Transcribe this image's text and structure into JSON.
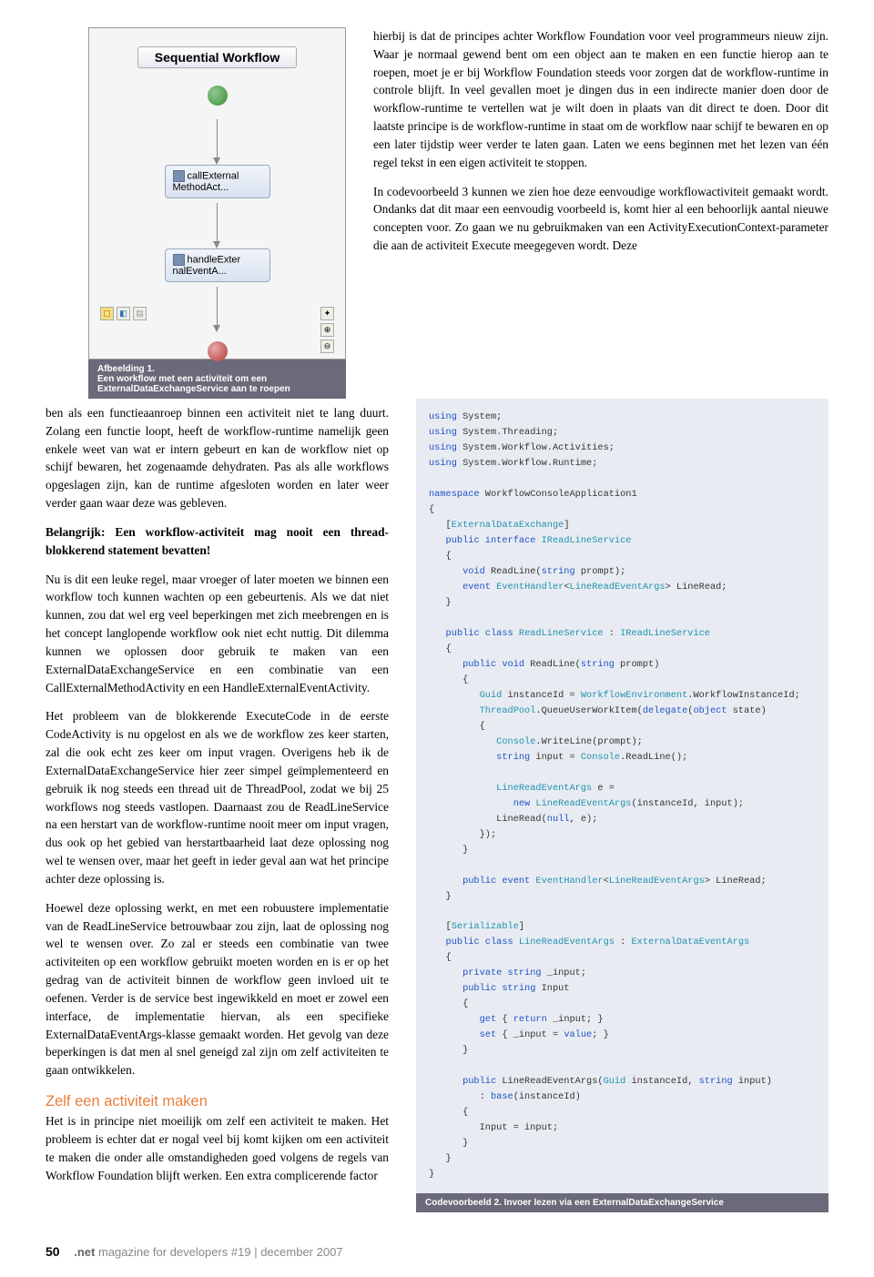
{
  "diagram": {
    "title": "Sequential Workflow",
    "activity1": "callExternal MethodAct...",
    "activity2": "handleExter nalEventA..."
  },
  "caption1_title": "Afbeelding 1.",
  "caption1_text": "Een workflow met een activiteit om een ExternalDataExchangeService aan te roepen",
  "right_p1": "hierbij is dat de principes achter Workflow Foundation voor veel programmeurs nieuw zijn. Waar je normaal gewend bent om een object aan te maken en een functie hierop aan te roepen, moet je er bij Workflow Foundation steeds voor zorgen dat de workflow-runtime in controle blijft. In veel gevallen moet je dingen dus in een indirecte manier doen door de workflow-runtime te vertellen wat je wilt doen in plaats van dit direct te doen. Door dit laatste principe is de workflow-runtime in staat om de workflow naar schijf te bewaren en op een later tijdstip weer verder te laten gaan. Laten we eens beginnen met het lezen van één regel tekst in een eigen activiteit te stoppen.",
  "right_p2": "In codevoorbeeld 3 kunnen we zien hoe deze eenvoudige workflowactiviteit gemaakt wordt. Ondanks dat dit maar een eenvoudig voorbeeld is, komt hier al een behoorlijk aantal nieuwe concepten voor. Zo gaan we nu gebruikmaken van een ActivityExecutionContext-parameter die aan de activiteit Execute meegegeven wordt. Deze",
  "left_p1": "ben als een functieaanroep binnen een activiteit niet te lang duurt. Zolang een functie loopt, heeft de workflow-runtime namelijk geen enkele weet van wat er intern gebeurt en kan de workflow niet op schijf bewaren, het zogenaamde dehydraten. Pas als alle workflows opgeslagen zijn, kan de runtime afgesloten worden en later weer verder gaan waar deze was gebleven.",
  "left_bold": "Belangrijk: Een workflow-activiteit mag nooit een thread-blokkerend statement bevatten!",
  "left_p2": "Nu is dit een leuke regel, maar vroeger of later moeten we binnen een workflow toch kunnen wachten op een gebeurtenis. Als we dat niet kunnen, zou dat wel erg veel beperkingen met zich meebrengen en is het concept langlopende workflow ook niet echt nuttig. Dit dilemma kunnen we oplossen door gebruik te maken van een ExternalDataExchangeService en een combinatie van een CallExternalMethodActivity en een HandleExternalEventActivity.",
  "left_p3": "Het probleem van de blokkerende ExecuteCode in de eerste CodeActivity is nu opgelost en als we de workflow zes keer starten, zal die ook echt zes keer om input vragen. Overigens heb ik de ExternalDataExchangeService hier zeer simpel geïmplementeerd en gebruik ik nog steeds een thread uit de ThreadPool, zodat we bij 25 workflows nog steeds vastlopen. Daarnaast zou de ReadLineService na een herstart van de workflow-runtime nooit meer om input vragen, dus ook op het gebied van herstartbaarheid laat deze oplossing nog wel te wensen over, maar het geeft in ieder geval aan wat het principe achter deze oplossing is.",
  "left_p4": "Hoewel deze oplossing werkt, en met een robuustere implementatie van de ReadLineService betrouwbaar zou zijn, laat de oplossing nog wel te wensen over. Zo zal er steeds een combinatie van twee activiteiten op een workflow gebruikt moeten worden en is er op het gedrag van de activiteit binnen de workflow geen invloed uit te oefenen. Verder is de service best ingewikkeld en moet er zowel een interface, de implementatie hiervan, als een specifieke ExternalDataEventArgs-klasse gemaakt worden. Het gevolg van deze beperkingen is dat men al snel geneigd zal zijn om zelf activiteiten te gaan ontwikkelen.",
  "section": "Zelf een activiteit maken",
  "left_p5": "Het is in principe niet moeilijk om zelf een activiteit te maken. Het probleem is echter dat er nogal veel bij komt kijken om een activiteit te maken die onder alle omstandigheden goed volgens de regels van Workflow Foundation blijft werken. Een extra complicerende factor",
  "code_caption": "Codevoorbeeld 2. Invoer lezen via een ExternalDataExchangeService",
  "footer": {
    "page": "50",
    "brand": ".net",
    "rest": " magazine for developers #19 | december 2007"
  }
}
